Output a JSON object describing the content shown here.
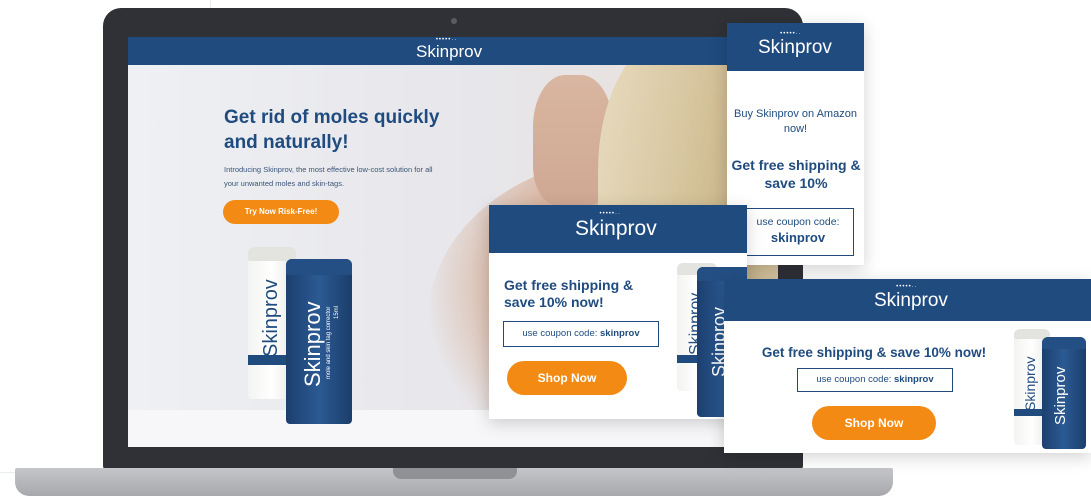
{
  "brand": {
    "logo_text": "Skinprov",
    "logo_dots": "•••••··",
    "primary_color": "#1f4b7f",
    "accent_color": "#f28a13"
  },
  "laptop": {
    "landing": {
      "headline": "Get rid of moles quickly and naturally!",
      "subtext": "Introducing Skinprov, the most effective low-cost solution for all your unwanted moles and skin-tags.",
      "cta_label": "Try Now Risk-Free!",
      "tube_blue_tagline": "mole and skin tag corrector",
      "tube_blue_size": "15ml"
    }
  },
  "banner_vertical": {
    "text": "Buy Skinprov on Amazon now!",
    "headline": "Get free shipping & save 10%",
    "coupon_label": "use coupon code:",
    "coupon_code": "skinprov"
  },
  "banner_medium": {
    "headline": "Get free shipping & save 10% now!",
    "coupon_label": "use coupon code:",
    "coupon_code": "skinprov",
    "cta_label": "Shop Now"
  },
  "banner_wide": {
    "headline": "Get free shipping & save 10% now!",
    "coupon_label": "use coupon code:",
    "coupon_code": "skinprov",
    "cta_label": "Shop Now"
  }
}
